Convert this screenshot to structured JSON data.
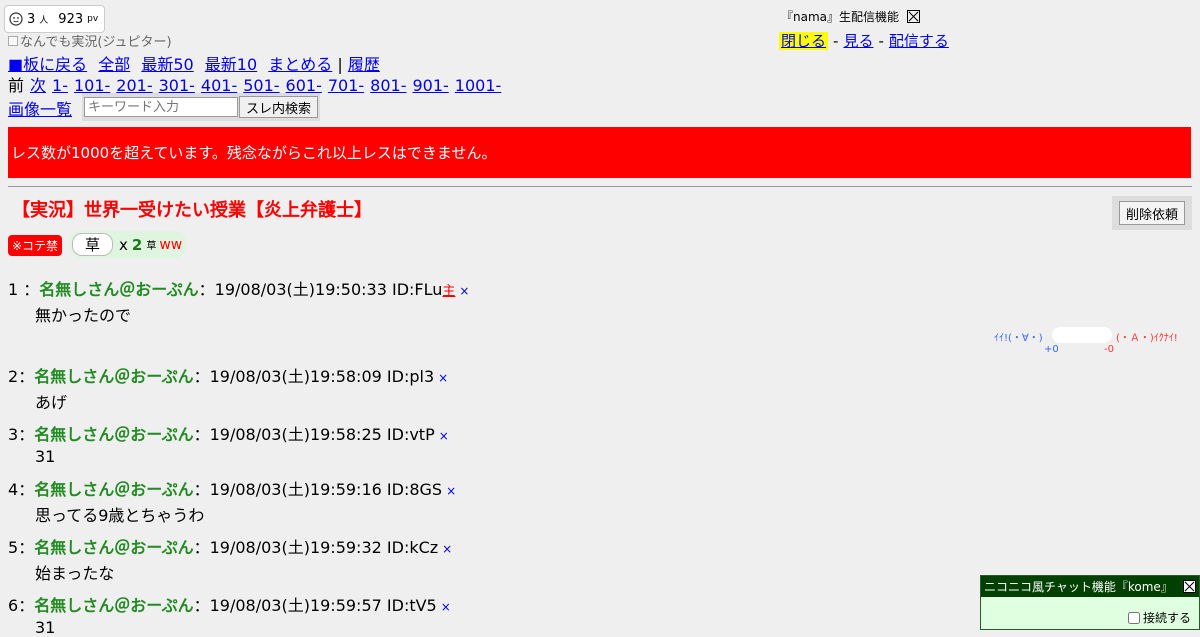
{
  "stats": {
    "viewers": "3",
    "viewers_unit": "人",
    "pv": "923",
    "pv_unit": "pv"
  },
  "board_note": "なんでも実況(ジュピター)",
  "nav": {
    "back": "■板に戻る",
    "all": "全部",
    "latest50": "最新50",
    "latest10": "最新10",
    "summarize": "まとめる",
    "sep": "|",
    "history": "履歴",
    "prev": "前",
    "next": "次",
    "ranges": [
      "1-",
      "101-",
      "201-",
      "301-",
      "401-",
      "501-",
      "601-",
      "701-",
      "801-",
      "901-",
      "1001-"
    ],
    "image_list": "画像一覧"
  },
  "search": {
    "placeholder": "キーワード入力",
    "button": "スレ内検索"
  },
  "nama": {
    "title": "『nama』生配信機能",
    "close": "閉じる",
    "watch": "見る",
    "broadcast": "配信する",
    "dash": "-"
  },
  "banner": "レス数が1000を超えています。残念ながらこれ以上レスはできません。",
  "thread_title": "【実況】世界一受けたい授業【炎上弁護士】",
  "delete_request": "削除依頼",
  "kote": "※コテ禁",
  "kusa": {
    "label": "草",
    "x": "x",
    "count": "2",
    "small": "草",
    "ww": "ww"
  },
  "posts": [
    {
      "num": "1",
      "name": "名無しさん＠おーぷん",
      "date": "19/08/03(土)19:50:33",
      "id": "ID:FLu",
      "owner": "主",
      "del": "×",
      "body": "無かったので"
    },
    {
      "num": "2",
      "name": "名無しさん＠おーぷん",
      "date": "19/08/03(土)19:58:09",
      "id": "ID:pl3",
      "del": "×",
      "body": "あげ"
    },
    {
      "num": "3",
      "name": "名無しさん＠おーぷん",
      "date": "19/08/03(土)19:58:25",
      "id": "ID:vtP",
      "del": "×",
      "body": "31"
    },
    {
      "num": "4",
      "name": "名無しさん＠おーぷん",
      "date": "19/08/03(土)19:59:16",
      "id": "ID:8GS",
      "del": "×",
      "body": "思ってる9歳とちゃうわ"
    },
    {
      "num": "5",
      "name": "名無しさん＠おーぷん",
      "date": "19/08/03(土)19:59:32",
      "id": "ID:kCz",
      "del": "×",
      "body": "始まったな"
    },
    {
      "num": "6",
      "name": "名無しさん＠おーぷん",
      "date": "19/08/03(土)19:59:57",
      "id": "ID:tV5",
      "del": "×",
      "body": "31"
    }
  ],
  "vote": {
    "good": "ｲｲ!(・∀・)",
    "bad": "(・Ａ・)ｲｸﾅｲ!",
    "plus": "+0",
    "minus": "-0"
  },
  "kome": {
    "title": "ニコニコ風チャット機能『kome』",
    "connect": "接続する"
  }
}
